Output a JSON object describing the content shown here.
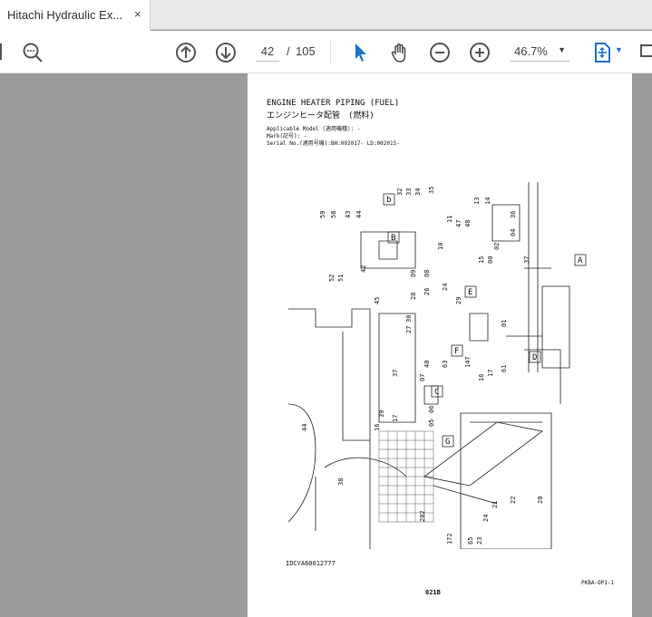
{
  "tab": {
    "title": "Hitachi Hydraulic Ex...",
    "close": "×"
  },
  "toolbar": {
    "page_current": "42",
    "page_sep": "/",
    "page_total": "105",
    "zoom": "46.7%"
  },
  "document": {
    "title_en": "ENGINE HEATER PIPING (FUEL)",
    "title_jp": "エンジンヒータ配管　(燃料)",
    "model": "Applicable Model (適用機種): -",
    "mark": "Mark(記号): -",
    "serial": "Serial No.(適用号機):BH:002017- LD:002015-",
    "drawing_id": "IDCYA60012777",
    "code": "PKBA-OP1-1",
    "page_code": "021B",
    "callouts": [
      "A",
      "B",
      "C",
      "D",
      "E",
      "F",
      "G",
      "b"
    ],
    "part_numbers": [
      "59",
      "58",
      "43",
      "44",
      "52",
      "51",
      "42",
      "32",
      "33",
      "34",
      "35",
      "10",
      "09",
      "08",
      "28",
      "26",
      "24",
      "29",
      "30",
      "27",
      "45",
      "44",
      "37",
      "13",
      "14",
      "11",
      "47",
      "48",
      "15",
      "00",
      "02",
      "04",
      "36",
      "37",
      "01",
      "147",
      "16",
      "17",
      "61",
      "07",
      "63",
      "40",
      "06",
      "05",
      "39",
      "16",
      "17",
      "38",
      "172",
      "24",
      "21",
      "22",
      "20",
      "202",
      "65",
      "23"
    ]
  }
}
